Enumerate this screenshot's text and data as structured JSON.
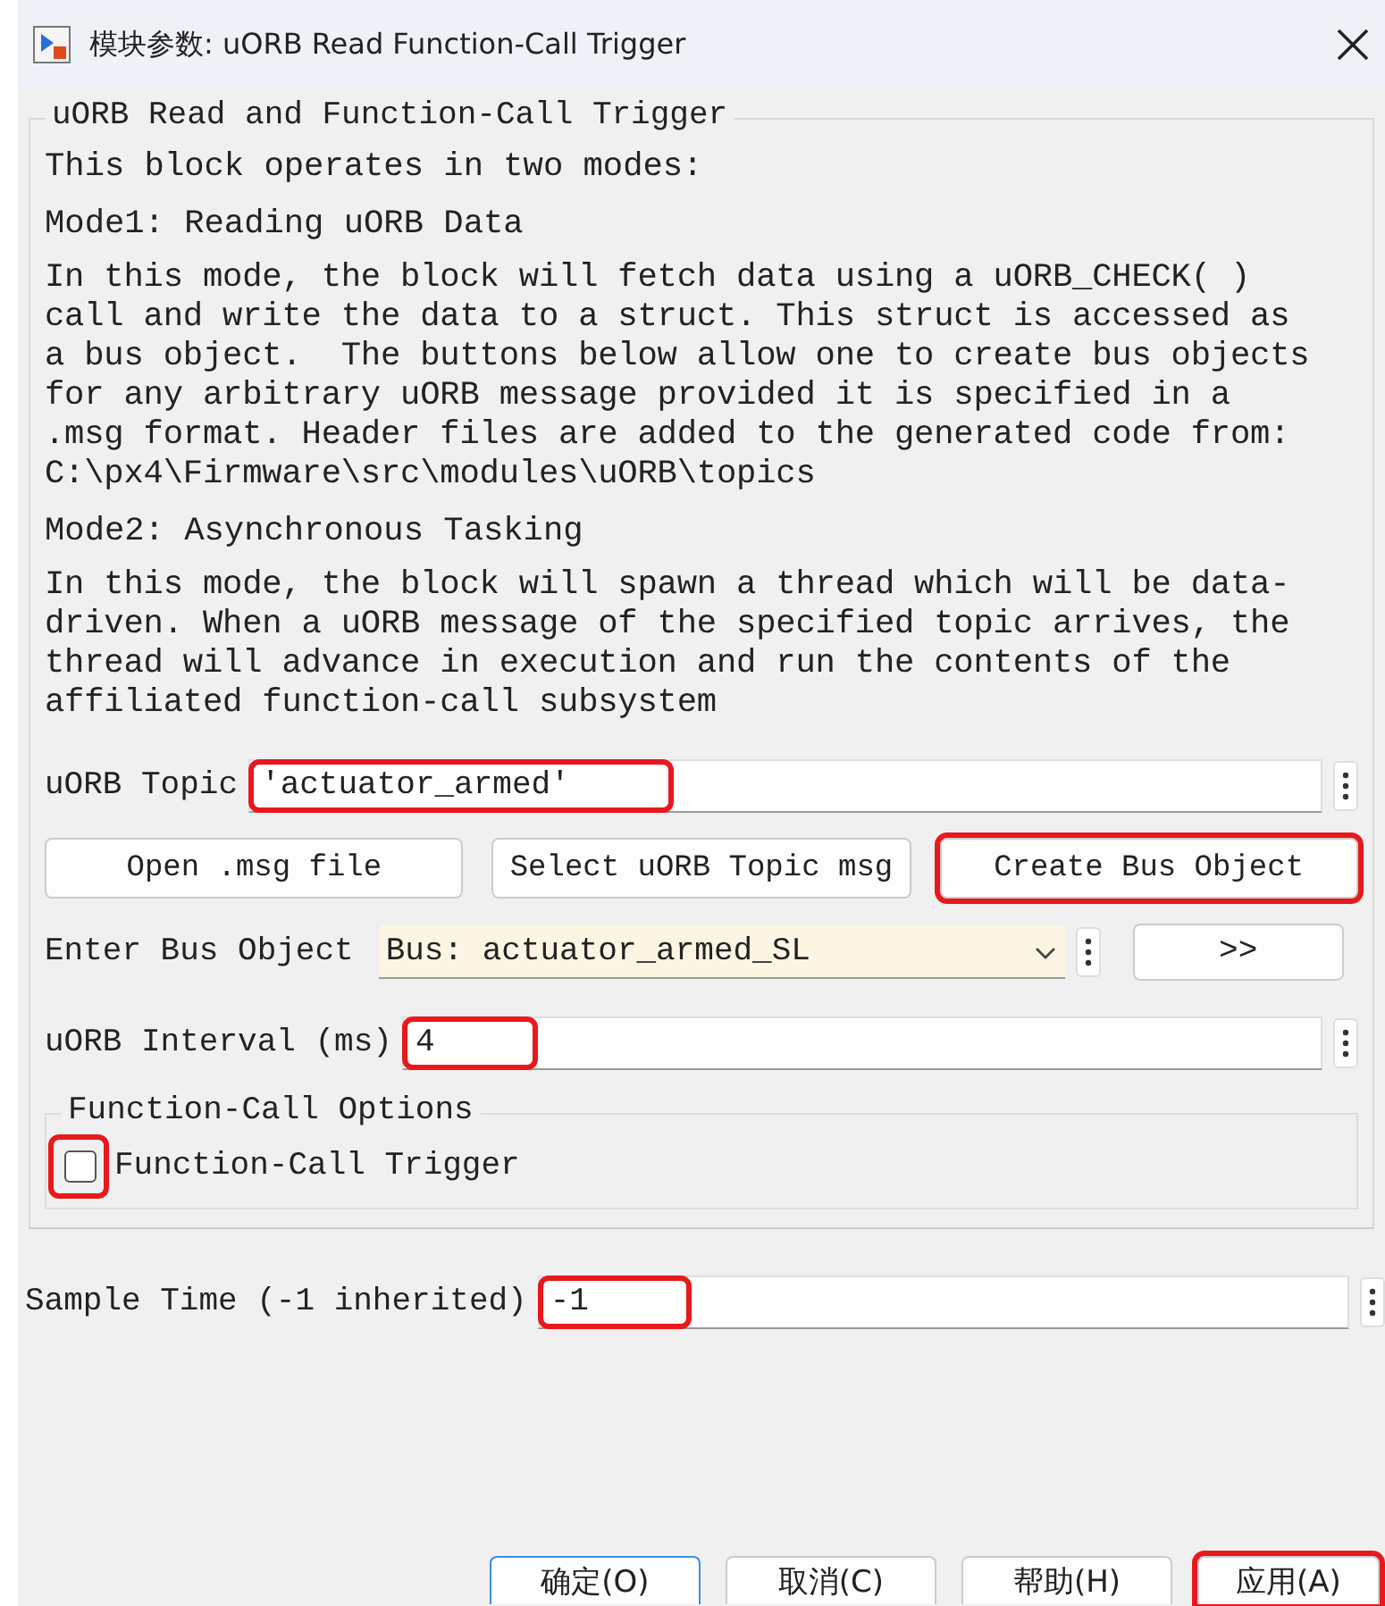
{
  "window": {
    "title": "模块参数: uORB Read Function-Call Trigger"
  },
  "group": {
    "title": "uORB Read and Function-Call Trigger"
  },
  "intro": "This block operates in two modes:",
  "mode1": {
    "heading": "Mode1: Reading uORB Data",
    "text": "In this mode, the block will fetch data using a uORB_CHECK( )\ncall and write the data to a struct. This struct is accessed as\na bus object.  The buttons below allow one to create bus objects\nfor any arbitrary uORB message provided it is specified in a\n.msg format. Header files are added to the generated code from:\nC:\\px4\\Firmware\\src\\modules\\uORB\\topics"
  },
  "mode2": {
    "heading": "Mode2: Asynchronous Tasking",
    "text": "In this mode, the block will spawn a thread which will be data-\ndriven. When a uORB message of the specified topic arrives, the\nthread will advance in execution and run the contents of the\naffiliated function-call subsystem"
  },
  "topic": {
    "label": "uORB Topic",
    "value": "'actuator_armed'",
    "highlighted": true
  },
  "topic_buttons": [
    {
      "label": "Open .msg file",
      "highlighted": false
    },
    {
      "label": "Select uORB Topic msg",
      "highlighted": false
    },
    {
      "label": "Create Bus Object",
      "highlighted": true
    }
  ],
  "bus_object": {
    "label": "Enter Bus Object",
    "value": "Bus: actuator_armed_SL",
    "button": ">>"
  },
  "interval": {
    "label": "uORB Interval (ms)",
    "value": "4",
    "highlighted": true
  },
  "options": {
    "title": "Function-Call Options",
    "checkbox": {
      "label": "Function-Call Trigger",
      "checked": false,
      "highlighted": true
    }
  },
  "sample_time": {
    "label": "Sample Time (-1 inherited)",
    "value": "-1",
    "highlighted": true
  },
  "dialog_buttons": [
    {
      "label": "确定(O)",
      "default": true,
      "highlighted": false
    },
    {
      "label": "取消(C)",
      "default": false,
      "highlighted": false
    },
    {
      "label": "帮助(H)",
      "default": false,
      "highlighted": false
    },
    {
      "label": "应用(A)",
      "default": false,
      "highlighted": true
    }
  ]
}
